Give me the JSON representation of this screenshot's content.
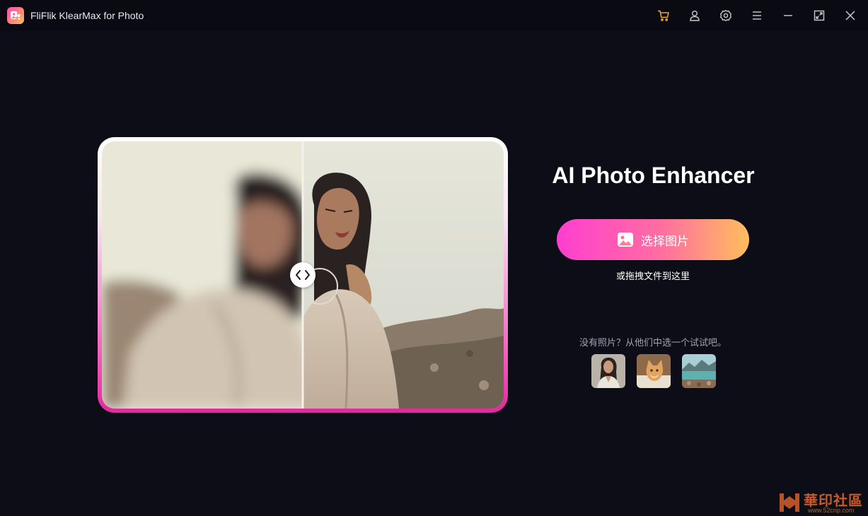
{
  "window": {
    "title": "FliFlik KlearMax for Photo"
  },
  "toolbar": {
    "icons": [
      "cart-icon",
      "user-icon",
      "settings-icon",
      "menu-icon",
      "minimize-icon",
      "maximize-icon",
      "close-icon"
    ],
    "cart_color": "#f5a623"
  },
  "main": {
    "title": "AI Photo Enhancer",
    "select_button_label": "选择图片",
    "drop_hint": "或拖拽文件到这里",
    "sample_hint": "没有照片？从他们中选一个试试吧。",
    "samples": [
      "sample-portrait",
      "sample-cat",
      "sample-landscape"
    ]
  },
  "colors": {
    "background": "#0d0d18",
    "button_gradient_start": "#ff3ed0",
    "button_gradient_end": "#ffbe5c",
    "frame_accent": "#e3279f"
  },
  "watermark": {
    "text": "華印社區",
    "url": "www.52cnp.com"
  }
}
